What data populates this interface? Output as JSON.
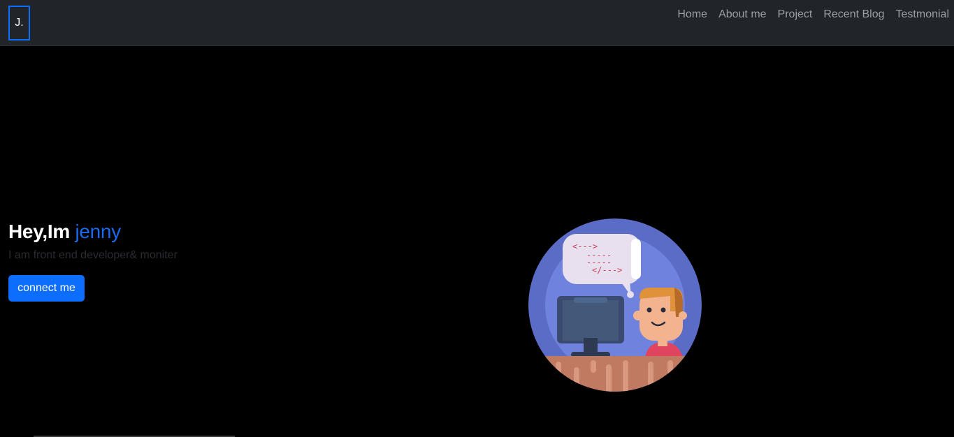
{
  "brand": {
    "logo_text": "J."
  },
  "nav": {
    "items": [
      {
        "label": "Home"
      },
      {
        "label": "About me"
      },
      {
        "label": "Project"
      },
      {
        "label": "Recent Blog"
      },
      {
        "label": "Testmonial"
      }
    ]
  },
  "hero": {
    "greeting": "Hey,Im",
    "name": "jenny",
    "subtitle": "I am front end developer& moniter",
    "cta_label": "connect me"
  },
  "illustration": {
    "code_lines": [
      "<--->",
      "-----",
      "-----",
      "</--->"
    ],
    "icon": "developer-at-computer-illustration"
  },
  "colors": {
    "navbar_bg": "#212529",
    "page_bg": "#000000",
    "accent": "#0d6efd",
    "name_accent": "#1a6af0"
  }
}
